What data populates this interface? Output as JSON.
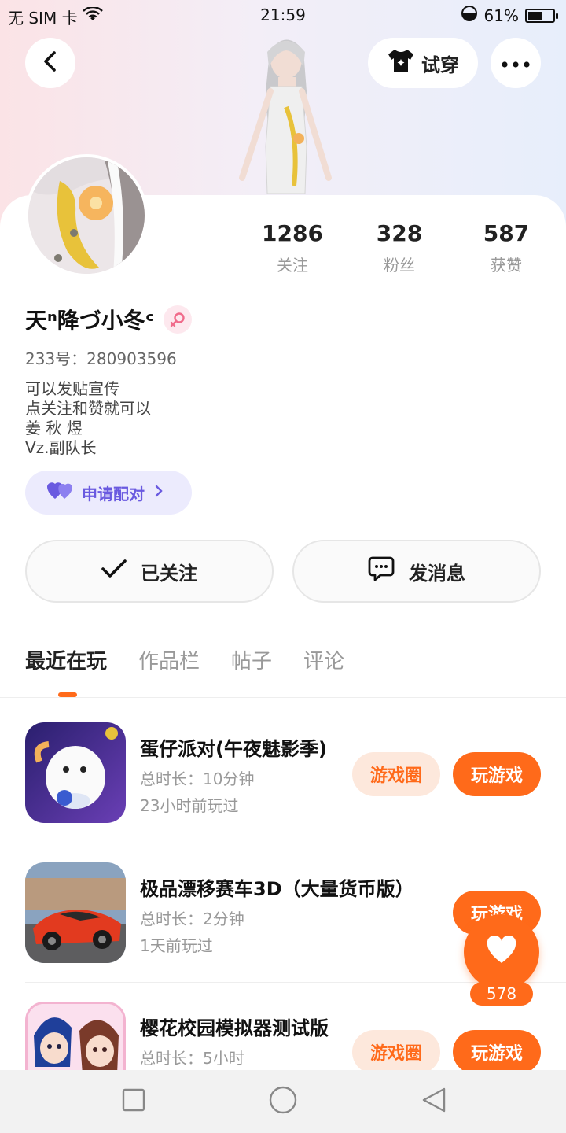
{
  "status_bar": {
    "carrier": "无 SIM 卡",
    "time": "21:59",
    "battery_percent": "61%",
    "battery_level": 0.61,
    "icons": [
      "wifi-icon",
      "data-saver-icon",
      "battery-icon"
    ]
  },
  "header": {
    "back_icon": "chevron-left-icon",
    "try_on_label": "试穿",
    "try_on_icon": "tshirt-icon",
    "more_icon": "more-dots-icon"
  },
  "profile": {
    "stats": [
      {
        "value": "1286",
        "label": "关注"
      },
      {
        "value": "328",
        "label": "粉丝"
      },
      {
        "value": "587",
        "label": "获赞"
      }
    ],
    "nickname": "天ⁿ降づ小冬ᶜ",
    "gender": "female",
    "uid": "233号：280903596",
    "bio_lines": [
      "可以发贴宣传",
      "点关注和赞就可以",
      "姜 秋 煜",
      "Vz.副队长"
    ],
    "match_label": "申请配对",
    "follow_label": "已关注",
    "message_label": "发消息"
  },
  "tabs": [
    {
      "label": "最近在玩",
      "active": true
    },
    {
      "label": "作品栏",
      "active": false
    },
    {
      "label": "帖子",
      "active": false
    },
    {
      "label": "评论",
      "active": false
    }
  ],
  "games": [
    {
      "name": "蛋仔派对(午夜魅影季)",
      "duration": "总时长：10分钟",
      "last_played": "23小时前玩过",
      "circle_label": "游戏圈",
      "play_label": "玩游戏"
    },
    {
      "name": "极品漂移赛车3D（大量货币版）",
      "duration": "总时长：2分钟",
      "last_played": "1天前玩过",
      "circle_label": "",
      "play_label": "玩游戏"
    },
    {
      "name": "樱花校园模拟器测试版",
      "duration": "总时长：5小时",
      "last_played": "",
      "circle_label": "游戏圈",
      "play_label": "玩游戏"
    }
  ],
  "floating_like": {
    "count": "578",
    "icon": "heart-icon"
  },
  "nav_bar": {
    "icons": [
      "square-icon",
      "circle-icon",
      "triangle-back-icon"
    ]
  },
  "colors": {
    "accent": "#ff6a1a",
    "accent_light": "#fde8dc",
    "match_purple": "#6a5ae0",
    "match_bg": "#ecebfd"
  }
}
